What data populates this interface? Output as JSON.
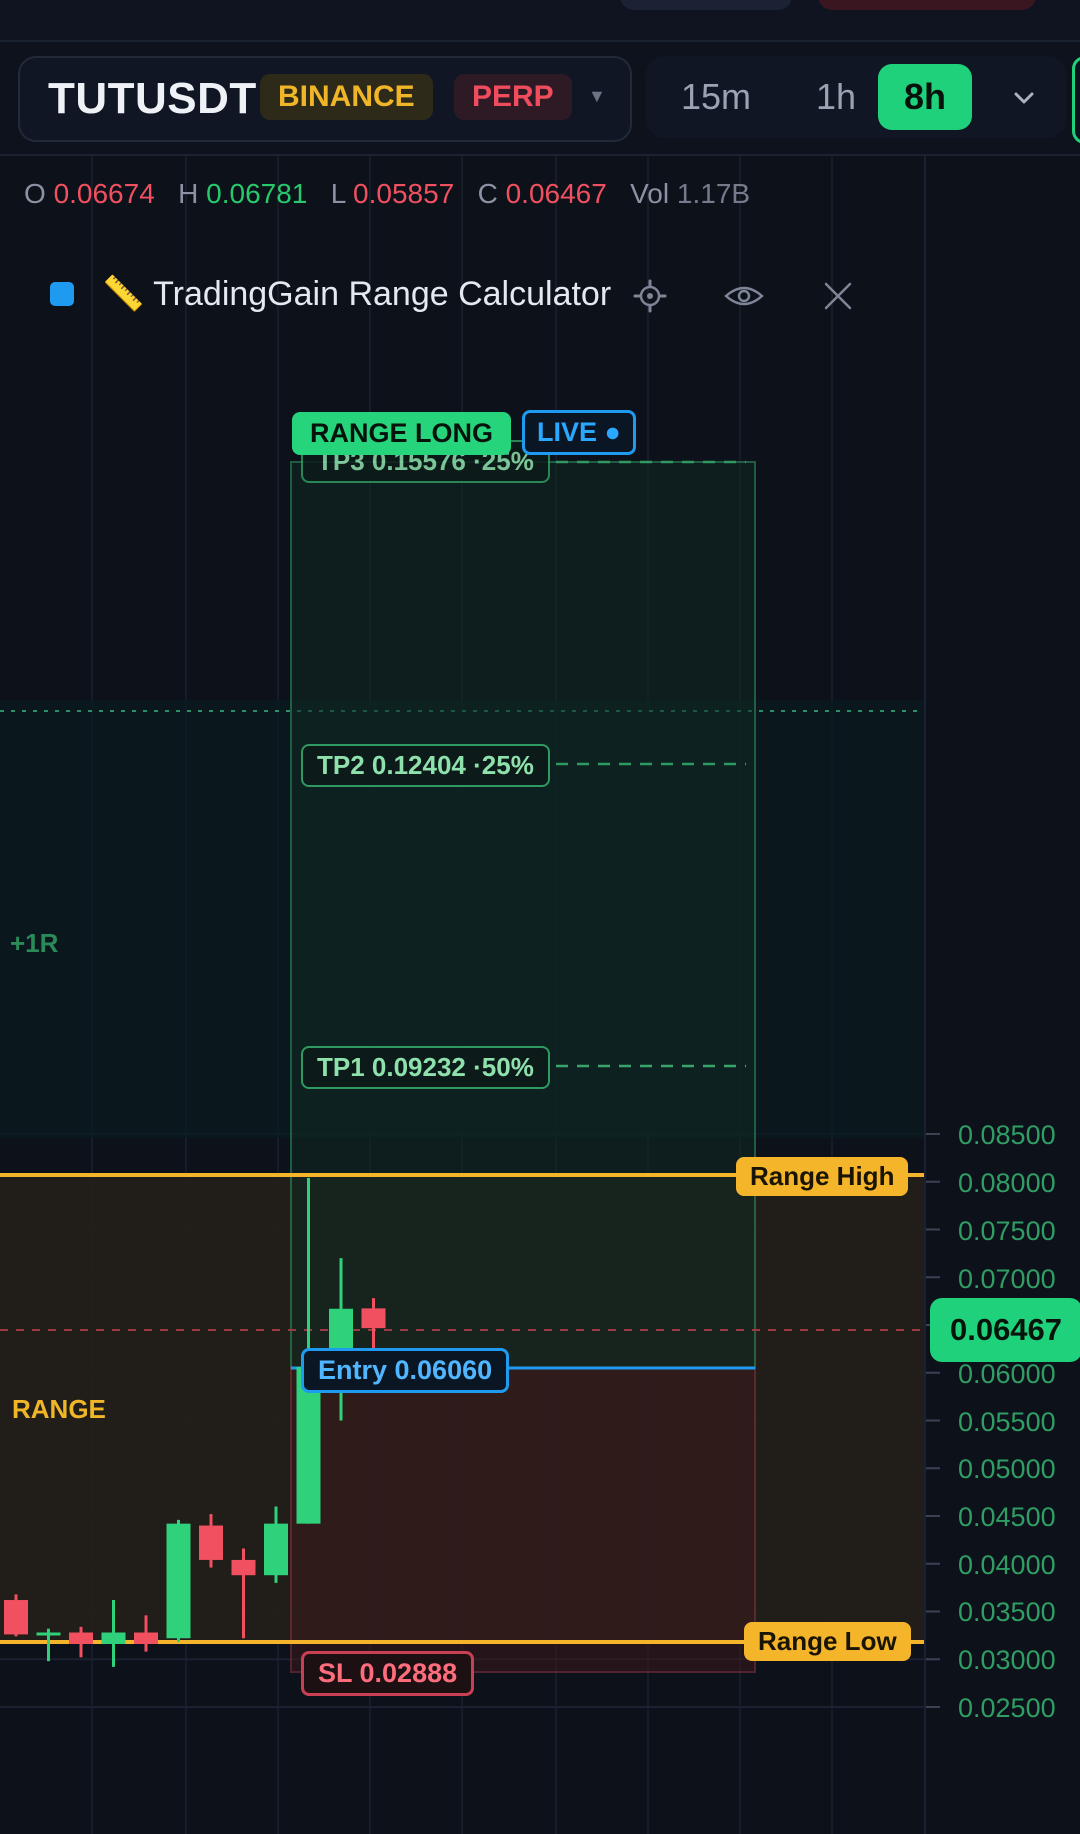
{
  "header": {
    "symbol": "TUTUSDT",
    "exchange": "BINANCE",
    "market_type": "PERP",
    "timeframes": [
      "15m",
      "1h",
      "8h"
    ],
    "active_timeframe": "8h"
  },
  "ohlc": {
    "o_label": "O",
    "o": "0.06674",
    "h_label": "H",
    "h": "0.06781",
    "l_label": "L",
    "l": "0.05857",
    "c_label": "C",
    "c": "0.06467",
    "vol_label": "Vol",
    "vol": "1.17B"
  },
  "indicator": {
    "title": "📏 TradingGain Range Calculator",
    "color": "#1e9bf0"
  },
  "overlay": {
    "range_long": "RANGE LONG",
    "live": "LIVE ●",
    "tp3": "TP3 0.15576 ·25%",
    "tp2": "TP2 0.12404 ·25%",
    "tp1": "TP1 0.09232 ·50%",
    "entry": "Entry 0.06060",
    "sl": "SL 0.02888",
    "range_high": "Range High",
    "range_low": "Range Low",
    "plus_1r": "+1R",
    "range": "RANGE"
  },
  "price_axis": {
    "ticks": [
      "0.08500",
      "0.08000",
      "0.07500",
      "0.07000",
      "0.06000",
      "0.05500",
      "0.05000",
      "0.04500",
      "0.04000",
      "0.03500",
      "0.03000",
      "0.02500"
    ],
    "current_price": "0.06467"
  },
  "chart_data": {
    "type": "candlestick",
    "ylim": [
      0.0225,
      0.0875
    ],
    "levels": {
      "range_high": 0.0804,
      "range_low": 0.032,
      "entry": 0.0606,
      "stop_loss": 0.02888,
      "tp1": 0.09232,
      "tp2": 0.12404,
      "tp3": 0.15576,
      "current": 0.06467
    },
    "candles": [
      {
        "o": 0.0362,
        "h": 0.0368,
        "l": 0.0324,
        "c": 0.0326
      },
      {
        "o": 0.0326,
        "h": 0.0332,
        "l": 0.0298,
        "c": 0.0328
      },
      {
        "o": 0.0328,
        "h": 0.0334,
        "l": 0.0302,
        "c": 0.0316
      },
      {
        "o": 0.0316,
        "h": 0.0362,
        "l": 0.0292,
        "c": 0.0328
      },
      {
        "o": 0.0328,
        "h": 0.0346,
        "l": 0.0308,
        "c": 0.0316
      },
      {
        "o": 0.0322,
        "h": 0.0446,
        "l": 0.0318,
        "c": 0.0442
      },
      {
        "o": 0.044,
        "h": 0.0452,
        "l": 0.0396,
        "c": 0.0404
      },
      {
        "o": 0.0404,
        "h": 0.0416,
        "l": 0.0322,
        "c": 0.0388
      },
      {
        "o": 0.0388,
        "h": 0.046,
        "l": 0.038,
        "c": 0.0442
      },
      {
        "o": 0.0442,
        "h": 0.0804,
        "l": 0.0442,
        "c": 0.0606
      },
      {
        "o": 0.0606,
        "h": 0.072,
        "l": 0.055,
        "c": 0.0667
      },
      {
        "o": 0.06674,
        "h": 0.06781,
        "l": 0.05857,
        "c": 0.06467
      }
    ]
  }
}
